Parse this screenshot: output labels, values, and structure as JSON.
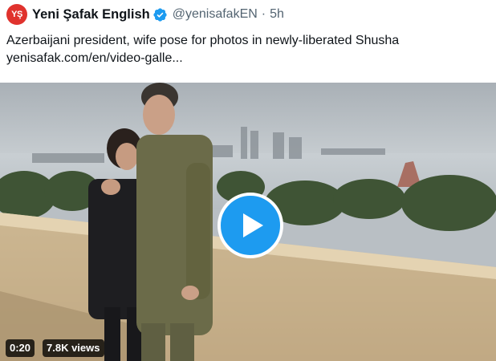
{
  "tweet": {
    "avatar_text": "YŞ",
    "display_name": "Yeni Şafak English",
    "handle": "@yenisafakEN",
    "separator": "·",
    "time": "5h",
    "text": "Azerbaijani president, wife pose for photos in newly-liberated Shusha",
    "link": "yenisafak.com/en/video-galle..."
  },
  "video": {
    "duration": "0:20",
    "views": "7.8K views"
  },
  "colors": {
    "accent": "#1d9bf0",
    "avatar_bg": "#e0322d"
  }
}
